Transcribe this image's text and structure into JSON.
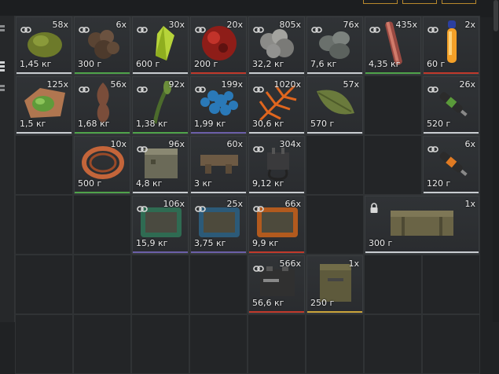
{
  "colors": {
    "background": "#202224",
    "cell_border": "#303335",
    "accent_gold": "#b8892d",
    "bar_white": "#c8ccd0",
    "bar_green": "#4fa34a",
    "bar_red": "#c0392b",
    "bar_purple": "#6b5fa8",
    "bar_yellow": "#c9a33a"
  },
  "icons": {
    "link": "link-icon",
    "lock": "lock-icon"
  },
  "items": [
    {
      "id": "moss-rock",
      "count": "58x",
      "weight": "1,45 кг",
      "bar": "white",
      "icon": "link-icon"
    },
    {
      "id": "brown-ore",
      "count": "6x",
      "weight": "300 г",
      "bar": "green",
      "icon": "link-icon"
    },
    {
      "id": "yellow-crystal",
      "count": "30x",
      "weight": "600 г",
      "bar": "white",
      "icon": "link-icon"
    },
    {
      "id": "red-orb",
      "count": "20x",
      "weight": "200 г",
      "bar": "red",
      "icon": "link-icon"
    },
    {
      "id": "grey-stone",
      "count": "805x",
      "weight": "32,2 кг",
      "bar": "white",
      "icon": "link-icon"
    },
    {
      "id": "dark-pebbles",
      "count": "76x",
      "weight": "7,6 кг",
      "bar": "white",
      "icon": "link-icon"
    },
    {
      "id": "metal-rod",
      "count": "435x",
      "weight": "4,35 кг",
      "bar": "green",
      "icon": "link-icon"
    },
    {
      "id": "orange-vial",
      "count": "2x",
      "weight": "60 г",
      "bar": "red",
      "icon": "link-icon"
    },
    {
      "id": "green-blob",
      "count": "125x",
      "weight": "1,5 кг",
      "bar": "white",
      "icon": "none"
    },
    {
      "id": "brown-root",
      "count": "56x",
      "weight": "1,68 кг",
      "bar": "green",
      "icon": "link-icon"
    },
    {
      "id": "green-stalk",
      "count": "92x",
      "weight": "1,38 кг",
      "bar": "green",
      "icon": "link-icon"
    },
    {
      "id": "blue-coral",
      "count": "199x",
      "weight": "1,99 кг",
      "bar": "purple",
      "icon": "link-icon"
    },
    {
      "id": "orange-fern",
      "count": "1020x",
      "weight": "30,6 кг",
      "bar": "white",
      "icon": "link-icon"
    },
    {
      "id": "green-leaf",
      "count": "57x",
      "weight": "570 г",
      "bar": "white",
      "icon": "none"
    },
    {
      "id": "green-syringe",
      "count": "26x",
      "weight": "520 г",
      "bar": "white",
      "icon": "link-icon"
    },
    {
      "id": "copper-coil",
      "count": "10x",
      "weight": "500 г",
      "bar": "green",
      "icon": "none"
    },
    {
      "id": "metal-box",
      "count": "96x",
      "weight": "4,8 кг",
      "bar": "white",
      "icon": "link-icon"
    },
    {
      "id": "brown-part",
      "count": "60x",
      "weight": "3 кг",
      "bar": "white",
      "icon": "none"
    },
    {
      "id": "cable-device",
      "count": "304x",
      "weight": "9,12 кг",
      "bar": "white",
      "icon": "link-icon"
    },
    {
      "id": "orange-syringe",
      "count": "6x",
      "weight": "120 г",
      "bar": "white",
      "icon": "link-icon"
    },
    {
      "id": "circuit-green",
      "count": "106x",
      "weight": "15,9 кг",
      "bar": "purple",
      "icon": "link-icon"
    },
    {
      "id": "circuit-blue",
      "count": "25x",
      "weight": "3,75 кг",
      "bar": "purple",
      "icon": "link-icon"
    },
    {
      "id": "circuit-orange",
      "count": "66x",
      "weight": "9,9 кг",
      "bar": "red",
      "icon": "link-icon"
    },
    {
      "id": "ammo-crate",
      "count": "1x",
      "weight": "300 г",
      "bar": "white",
      "icon": "lock-icon"
    },
    {
      "id": "battery",
      "count": "566x",
      "weight": "56,6 кг",
      "bar": "red",
      "icon": "link-icon"
    },
    {
      "id": "military-case",
      "count": "1x",
      "weight": "250 г",
      "bar": "yellow",
      "icon": "none"
    }
  ]
}
